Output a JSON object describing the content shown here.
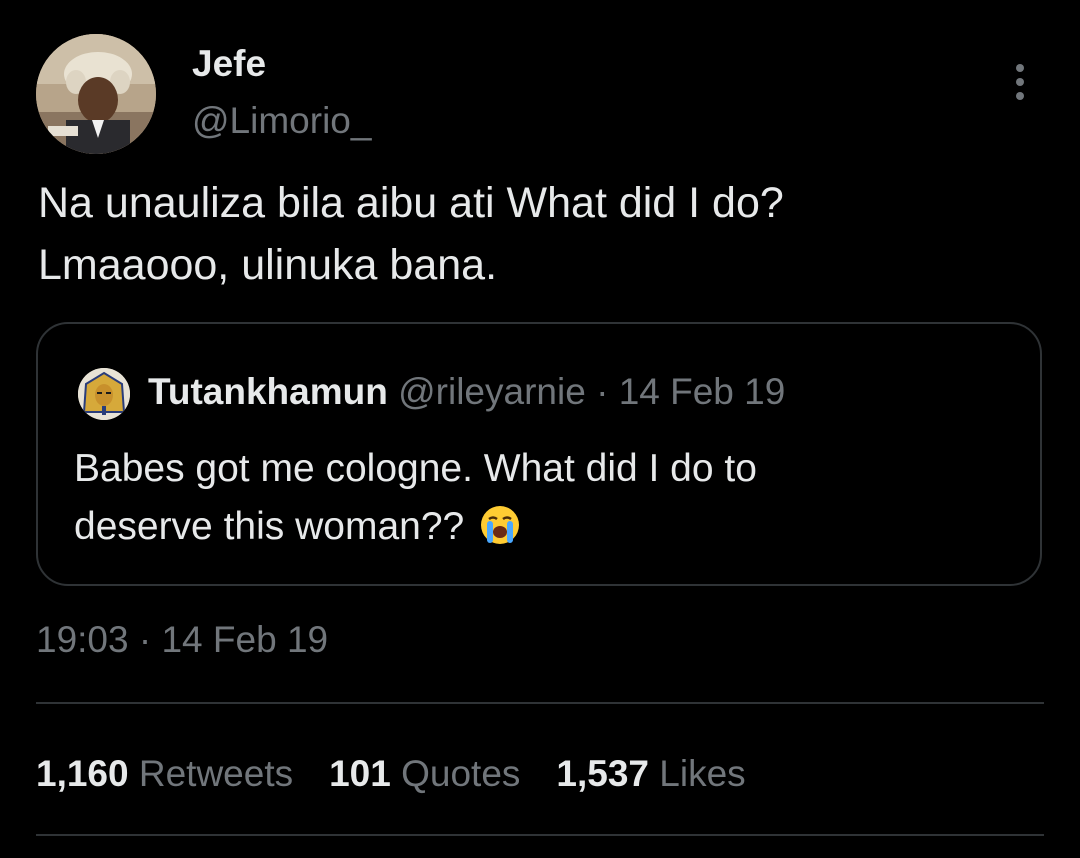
{
  "author": {
    "name": "Jefe",
    "handle": "@Limorio_"
  },
  "tweet": {
    "lines": [
      "Na unauliza bila aibu ati What did I do?",
      "Lmaaooo, ulinuka bana."
    ],
    "timestamp": "19:03 · 14 Feb 19"
  },
  "quoted": {
    "name": "Tutankhamun",
    "handle": "@rileyarnie",
    "separator": "·",
    "date": "14 Feb 19",
    "lines": [
      "Babes got me cologne. What did I do to",
      "deserve this woman?? "
    ],
    "emoji": "loudly-crying-face"
  },
  "stats": {
    "retweets": {
      "count": "1,160",
      "label": "Retweets"
    },
    "quotes": {
      "count": "101",
      "label": "Quotes"
    },
    "likes": {
      "count": "1,537",
      "label": "Likes"
    }
  },
  "icons": {
    "more": "more-horizontal-dots-icon"
  },
  "colors": {
    "background": "#000000",
    "primary_text": "#e7e9ea",
    "secondary_text": "#71767b",
    "border": "#2f3336"
  }
}
